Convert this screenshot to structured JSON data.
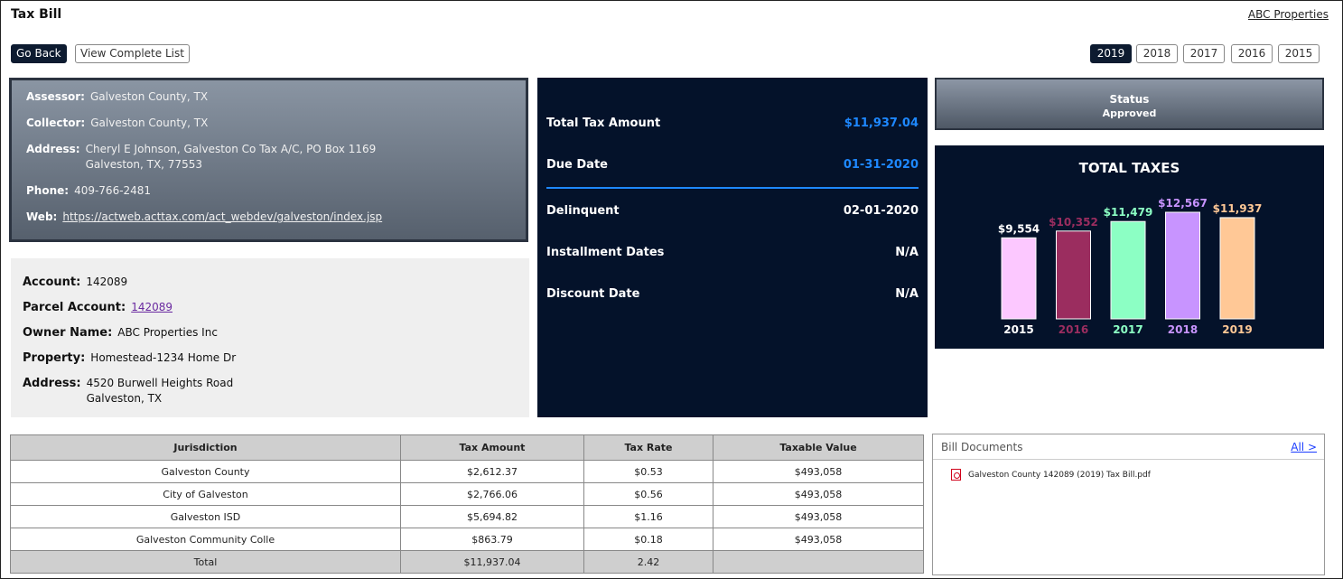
{
  "header": {
    "title": "Tax Bill",
    "company": "ABC Properties",
    "go_back": "Go Back",
    "view_list": "View Complete List",
    "years": [
      "2019",
      "2018",
      "2017",
      "2016",
      "2015"
    ],
    "active_year": "2019"
  },
  "assessor": {
    "assessor_label": "Assessor:",
    "assessor": "Galveston County, TX",
    "collector_label": "Collector:",
    "collector": "Galveston County, TX",
    "address_label": "Address:",
    "address_line1": "Cheryl E Johnson, Galveston Co Tax A/C, PO Box 1169",
    "address_line2": "Galveston, TX, 77553",
    "phone_label": "Phone:",
    "phone": "409-766-2481",
    "web_label": "Web:",
    "web": "https://actweb.acttax.com/act_webdev/galveston/index.jsp"
  },
  "account": {
    "account_label": "Account:",
    "account": "142089",
    "parcel_label": "Parcel Account:",
    "parcel": "142089",
    "owner_label": "Owner Name:",
    "owner": "ABC Properties Inc",
    "property_label": "Property:",
    "property": "Homestead-1234 Home Dr",
    "address_label": "Address:",
    "address_line1": "4520 Burwell Heights Road",
    "address_line2": "Galveston, TX"
  },
  "details": {
    "total_label": "Total Tax Amount",
    "total": "$11,937.04",
    "due_label": "Due Date",
    "due": "01-31-2020",
    "delinquent_label": "Delinquent",
    "delinquent": "02-01-2020",
    "installment_label": "Installment Dates",
    "installment": "N/A",
    "discount_label": "Discount Date",
    "discount": "N/A"
  },
  "status": {
    "title": "Status",
    "value": "Approved"
  },
  "chart_data": {
    "type": "bar",
    "title": "TOTAL TAXES",
    "categories": [
      "2015",
      "2016",
      "2017",
      "2018",
      "2019"
    ],
    "values": [
      9554,
      10352,
      11479,
      12567,
      11937
    ],
    "labels": [
      "$9,554",
      "$10,352",
      "$11,479",
      "$12,567",
      "$11,937"
    ],
    "colors": [
      "#fcc8ff",
      "#9b2d5f",
      "#8cffc4",
      "#c894ff",
      "#ffc896"
    ]
  },
  "table": {
    "headers": [
      "Jurisdiction",
      "Tax Amount",
      "Tax Rate",
      "Taxable Value"
    ],
    "rows": [
      [
        "Galveston County",
        "$2,612.37",
        "$0.53",
        "$493,058"
      ],
      [
        "City of Galveston",
        "$2,766.06",
        "$0.56",
        "$493,058"
      ],
      [
        "Galveston ISD",
        "$5,694.82",
        "$1.16",
        "$493,058"
      ],
      [
        "Galveston Community Colle",
        "$863.79",
        "$0.18",
        "$493,058"
      ]
    ],
    "total": [
      "Total",
      "$11,937.04",
      "2.42",
      ""
    ]
  },
  "documents": {
    "title": "Bill Documents",
    "all_link": "All >",
    "files": [
      "Galveston County 142089 (2019) Tax Bill.pdf"
    ]
  }
}
